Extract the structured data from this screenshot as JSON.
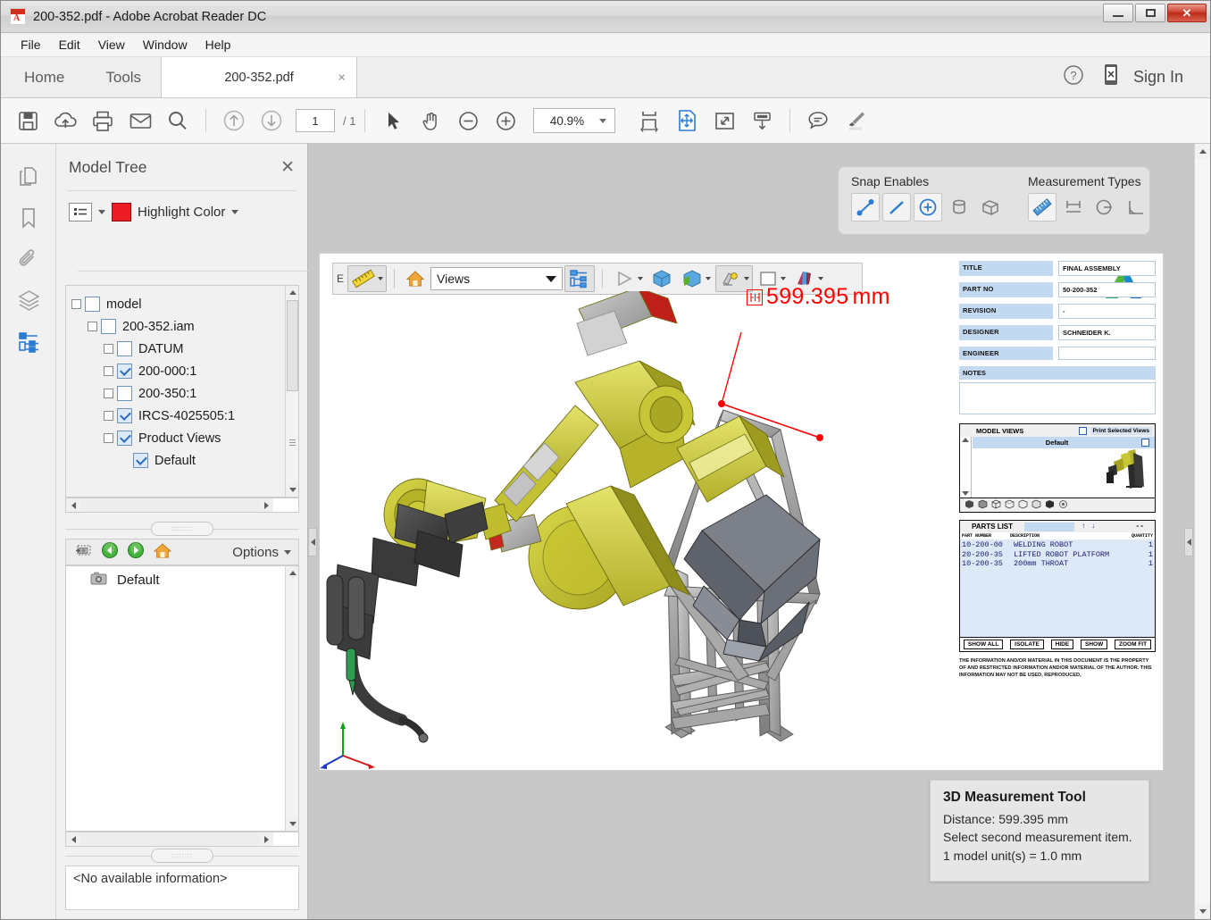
{
  "window": {
    "title": "200-352.pdf - Adobe Acrobat Reader DC",
    "app_icon": "pdf-icon",
    "minimize": "–",
    "maximize": "□",
    "close": "✕"
  },
  "menubar": {
    "items": [
      "File",
      "Edit",
      "View",
      "Window",
      "Help"
    ]
  },
  "tabbar": {
    "home": "Home",
    "tools": "Tools",
    "document_tab": "200-352.pdf",
    "tab_close": "×",
    "help_icon": "help-circle-icon",
    "mobile_icon": "mobile-link-icon",
    "sign_in": "Sign In"
  },
  "toolbar": {
    "save_icon": "save-icon",
    "cloud_icon": "cloud-upload-icon",
    "print_icon": "print-icon",
    "email_icon": "email-icon",
    "search_icon": "search-icon",
    "prev_page_icon": "arrow-up-circle-icon",
    "next_page_icon": "arrow-down-circle-icon",
    "page_value": "1",
    "page_total": "/ 1",
    "select_icon": "cursor-arrow-icon",
    "hand_icon": "hand-tool-icon",
    "zoom_out_icon": "zoom-out-icon",
    "zoom_in_icon": "zoom-in-icon",
    "zoom_value": "40.9%",
    "fit_width_icon": "fit-width-icon",
    "fit_page_icon": "fit-page-icon",
    "fullscreen_icon": "fullscreen-icon",
    "scroll_icon": "scroll-mode-icon",
    "comment_icon": "comment-icon",
    "highlight_icon": "highlighter-icon"
  },
  "rail": {
    "items": [
      {
        "name": "page-thumbnails-icon",
        "active": false
      },
      {
        "name": "bookmarks-icon",
        "active": false
      },
      {
        "name": "attachments-icon",
        "active": false
      },
      {
        "name": "layers-icon",
        "active": false
      },
      {
        "name": "model-tree-icon",
        "active": true
      }
    ]
  },
  "model_tree_panel": {
    "title": "Model Tree",
    "close_icon": "close-icon",
    "list_view_icon": "list-view-icon",
    "highlight_color_label": "Highlight Color",
    "highlight_color_hex": "#ec1c24",
    "tree": [
      {
        "label": "model",
        "depth": 0,
        "checked": false,
        "expander": true
      },
      {
        "label": "200-352.iam",
        "depth": 1,
        "checked": false,
        "expander": true
      },
      {
        "label": "DATUM",
        "depth": 2,
        "checked": false,
        "expander": true
      },
      {
        "label": "200-000:1",
        "depth": 2,
        "checked": true,
        "expander": true
      },
      {
        "label": "200-350:1",
        "depth": 2,
        "checked": false,
        "expander": true
      },
      {
        "label": "IRCS-4025505:1",
        "depth": 2,
        "checked": true,
        "expander": true
      },
      {
        "label": "Product Views",
        "depth": 2,
        "checked": true,
        "expander": true
      },
      {
        "label": "Default",
        "depth": 3,
        "checked": true,
        "expander": false
      }
    ],
    "views_toolbar": {
      "add_view_icon": "add-view-camera-icon",
      "prev_icon": "previous-view-icon",
      "next_icon": "next-view-icon",
      "home_icon": "home-view-icon",
      "options_label": "Options"
    },
    "views_list": [
      {
        "label": "Default",
        "icon": "camera-icon"
      }
    ],
    "info_text": "<No available information>"
  },
  "document": {
    "snap_panel": {
      "snap_title": "Snap Enables",
      "measurement_title": "Measurement Types",
      "snap_icons": [
        {
          "name": "snap-to-endpoint-icon",
          "selected": false
        },
        {
          "name": "snap-to-edge-icon",
          "selected": false
        },
        {
          "name": "snap-to-silhouette-icon",
          "selected": true
        },
        {
          "name": "snap-to-radial-icon",
          "selected": false
        },
        {
          "name": "snap-to-planar-icon",
          "selected": false
        }
      ],
      "measurement_icons": [
        {
          "name": "3d-distance-tool-icon",
          "selected": true
        },
        {
          "name": "3d-perpendicular-dimension-icon",
          "selected": false
        },
        {
          "name": "3d-radial-dimension-icon",
          "selected": false
        },
        {
          "name": "3d-angle-dimension-icon",
          "selected": false
        }
      ]
    },
    "model_toolbar": {
      "edge_letter": "E",
      "measure_icon": "measure-ruler-icon",
      "home_icon": "home-icon",
      "views_value": "Views",
      "tree_icon": "model-tree-toggle-icon",
      "play_icon": "play-animation-icon",
      "render_icon": "render-mode-icon",
      "shade_icon": "shading-mode-icon",
      "light_icon": "lighting-icon",
      "background_icon": "background-color-icon",
      "cross_section_icon": "cross-section-icon"
    },
    "measurement_label": {
      "badge_icon": "distance-measure-icon",
      "value": "599.395",
      "unit": "mm"
    },
    "title_block": {
      "rows": [
        {
          "key": "TITLE",
          "value": "FINAL ASSEMBLY"
        },
        {
          "key": "PART NO",
          "value": "50-200-352"
        },
        {
          "key": "REVISION",
          "value": "-"
        },
        {
          "key": "DESIGNER",
          "value": "SCHNEIDER K."
        },
        {
          "key": "ENGINEER",
          "value": ""
        }
      ],
      "notes_key": "NOTES",
      "notes_value": ""
    },
    "model_views": {
      "header": "MODEL VIEWS",
      "print_label": "Print Selected Views",
      "rows": [
        "Default"
      ],
      "footer_icons": [
        "view-solid-icon",
        "view-shaded-icon",
        "view-wireframe-icon",
        "view-hidden-line-icon",
        "view-illustration-icon",
        "view-transparent-icon",
        "view-solid-outline-icon",
        "view-vertices-icon"
      ]
    },
    "parts_list": {
      "title": "PARTS LIST",
      "sort_up_icon": "sort-ascending-icon",
      "sort_down_icon": "sort-descending-icon",
      "dash": "--",
      "columns": [
        "PART NUMBER",
        "DESCRIPTION",
        "QUANTITY"
      ],
      "rows": [
        {
          "part_number": "10-200-00",
          "description": "WELDING ROBOT",
          "quantity": "1"
        },
        {
          "part_number": "20-200-35",
          "description": "LIFTED ROBOT PLATFORM",
          "quantity": "1"
        },
        {
          "part_number": "10-200-35",
          "description": "200mm THROAT",
          "quantity": "1"
        }
      ],
      "buttons": [
        "SHOW ALL",
        "ISOLATE",
        "HIDE",
        "SHOW",
        "ZOOM FIT"
      ]
    },
    "legal_text": "THE INFORMATION AND/OR MATERIAL IN THIS DOCUMENT IS THE PROPERTY OF AND RESTRICTED INFORMATION AND/OR MATERIAL OF THE AUTHOR. THIS INFORMATION MAY NOT BE USED, REPRODUCED,",
    "brand_logo": "autodesk-logo"
  },
  "tooltip": {
    "title": "3D Measurement Tool",
    "line1": "Distance: 599.395 mm",
    "line2": "Select second measurement item.",
    "line3": "1 model unit(s) = 1.0 mm"
  },
  "colors": {
    "accent_blue": "#2b7cd3",
    "measurement_red": "#ff0000",
    "highlight_red": "#ec1c24",
    "page_bg": "#c8c8c8"
  }
}
